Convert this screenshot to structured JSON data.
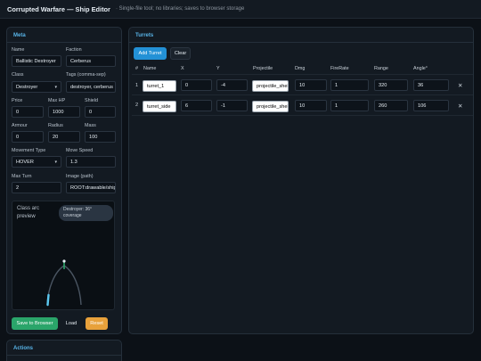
{
  "header": {
    "title": "Corrupted Warfare — Ship Editor",
    "subtitle": "· Single-file tool; no libraries; saves to browser storage"
  },
  "meta": {
    "title": "Meta",
    "name": {
      "label": "Name",
      "value": "Ballistic Destroyer"
    },
    "faction": {
      "label": "Faction",
      "value": "Cerberus"
    },
    "class": {
      "label": "Class",
      "value": "Destroyer"
    },
    "tags": {
      "label": "Tags (comma-sep)",
      "value": "destroyer, cerberus"
    },
    "price": {
      "label": "Price",
      "value": "0"
    },
    "max_hp": {
      "label": "Max HP",
      "value": "1000"
    },
    "shield": {
      "label": "Shield",
      "value": "0"
    },
    "armour": {
      "label": "Armour",
      "value": "0"
    },
    "radius": {
      "label": "Radius",
      "value": "20"
    },
    "mass": {
      "label": "Mass",
      "value": "100"
    },
    "movement_type": {
      "label": "Movement Type",
      "value": "HOVER"
    },
    "move_speed": {
      "label": "Move Speed",
      "value": "1.3"
    },
    "max_turn": {
      "label": "Max Turn",
      "value": "2"
    },
    "image": {
      "label": "Image (path)",
      "value": "ROOT:drawable/ships"
    },
    "preview": {
      "title": "Class arc preview",
      "badge": "Destroyer: 36° coverage",
      "coverage_deg": 36
    },
    "buttons": {
      "save": "Save to Browser",
      "load": "Load",
      "reset": "Reset"
    }
  },
  "actions": {
    "title": "Actions"
  },
  "turrets": {
    "title": "Turrets",
    "buttons": {
      "add": "Add Turret",
      "clear": "Clear"
    },
    "columns": [
      "#",
      "Name",
      "X",
      "Y",
      "Projectile",
      "Dmg",
      "FireRate",
      "Range",
      "Angle°"
    ],
    "rows": [
      {
        "num": "1",
        "name": "turret_1",
        "x": "0",
        "y": "-4",
        "projectile": "projectile_shell",
        "dmg": "10",
        "firerate": "1",
        "range": "320",
        "angle": "36",
        "delete": "✕"
      },
      {
        "num": "2",
        "name": "turret_side",
        "x": "6",
        "y": "-1",
        "projectile": "projectile_shell",
        "dmg": "10",
        "firerate": "1",
        "range": "260",
        "angle": "106",
        "delete": "✕"
      }
    ]
  },
  "colors": {
    "accent": "#58b4e8",
    "save": "#2aa56a",
    "reset": "#e8a13b",
    "add": "#2391d6",
    "arc": "#5bc8f0"
  }
}
